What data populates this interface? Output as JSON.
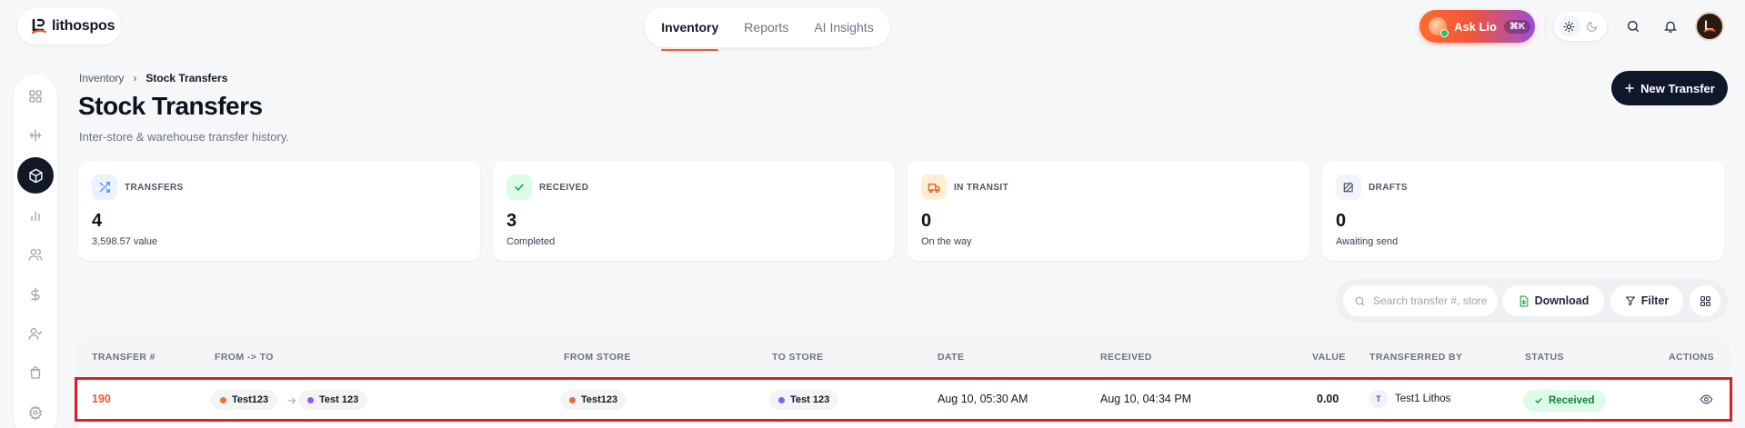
{
  "brand": {
    "name": "lithospos"
  },
  "topnav": {
    "tabs": [
      {
        "label": "Inventory",
        "active": true
      },
      {
        "label": "Reports",
        "active": false
      },
      {
        "label": "AI Insights",
        "active": false
      }
    ]
  },
  "assistant": {
    "label": "Ask Lio",
    "shortcut": "⌘K"
  },
  "header_icons": [
    "sun-icon",
    "moon-icon",
    "search-icon",
    "bell-icon",
    "avatar"
  ],
  "sidebar": {
    "items": [
      {
        "icon": "grid-icon",
        "active": false
      },
      {
        "icon": "transfer-icon",
        "active": false
      },
      {
        "icon": "box-icon",
        "active": true
      },
      {
        "icon": "bar-chart-icon",
        "active": false
      },
      {
        "icon": "users-icon",
        "active": false
      },
      {
        "icon": "dollar-icon",
        "active": false
      },
      {
        "icon": "user-check-icon",
        "active": false
      },
      {
        "icon": "shopping-bag-icon",
        "active": false
      },
      {
        "icon": "gear-icon",
        "active": false
      }
    ]
  },
  "breadcrumb": {
    "parent": "Inventory",
    "separator": "›",
    "current": "Stock Transfers"
  },
  "page": {
    "title": "Stock Transfers",
    "subtitle": "Inter-store & warehouse transfer history."
  },
  "new_transfer_button": {
    "label": "New Transfer"
  },
  "stats": [
    {
      "label": "TRANSFERS",
      "value": "4",
      "sub": "3,598.57 value",
      "icon": "shuffle-icon",
      "icon_bg": "#eaf2fe",
      "icon_color": "#3b82f6"
    },
    {
      "label": "RECEIVED",
      "value": "3",
      "sub": "Completed",
      "icon": "check-icon",
      "icon_bg": "#dcfce7",
      "icon_color": "#16a34a"
    },
    {
      "label": "IN TRANSIT",
      "value": "0",
      "sub": "On the way",
      "icon": "truck-icon",
      "icon_bg": "#ffedd5",
      "icon_color": "#ea580c"
    },
    {
      "label": "DRAFTS",
      "value": "0",
      "sub": "Awaiting send",
      "icon": "edit-icon",
      "icon_bg": "#f1f5f9",
      "icon_color": "#475569"
    }
  ],
  "toolbar": {
    "search_placeholder": "Search transfer #, store",
    "download_label": "Download",
    "filter_label": "Filter"
  },
  "table": {
    "columns": [
      "TRANSFER #",
      "FROM -> TO",
      "FROM STORE",
      "TO STORE",
      "DATE",
      "RECEIVED",
      "VALUE",
      "TRANSFERRED BY",
      "STATUS",
      "ACTIONS"
    ],
    "rows": [
      {
        "transfer_no": "190",
        "from": "Test123",
        "to": "Test 123",
        "from_store": "Test123",
        "to_store": "Test 123",
        "date": "Aug 10, 05:30 AM",
        "received": "Aug 10, 04:34 PM",
        "value": "0.00",
        "transferred_by_initial": "T",
        "transferred_by": "Test1 Lithos",
        "status": "Received"
      }
    ]
  },
  "colors": {
    "accent_orange": "#f05a28",
    "from_dot": "#f26a3d",
    "to_dot": "#8b5cf6",
    "primary_dark": "#0f172a",
    "highlight_border": "#e11d24"
  }
}
